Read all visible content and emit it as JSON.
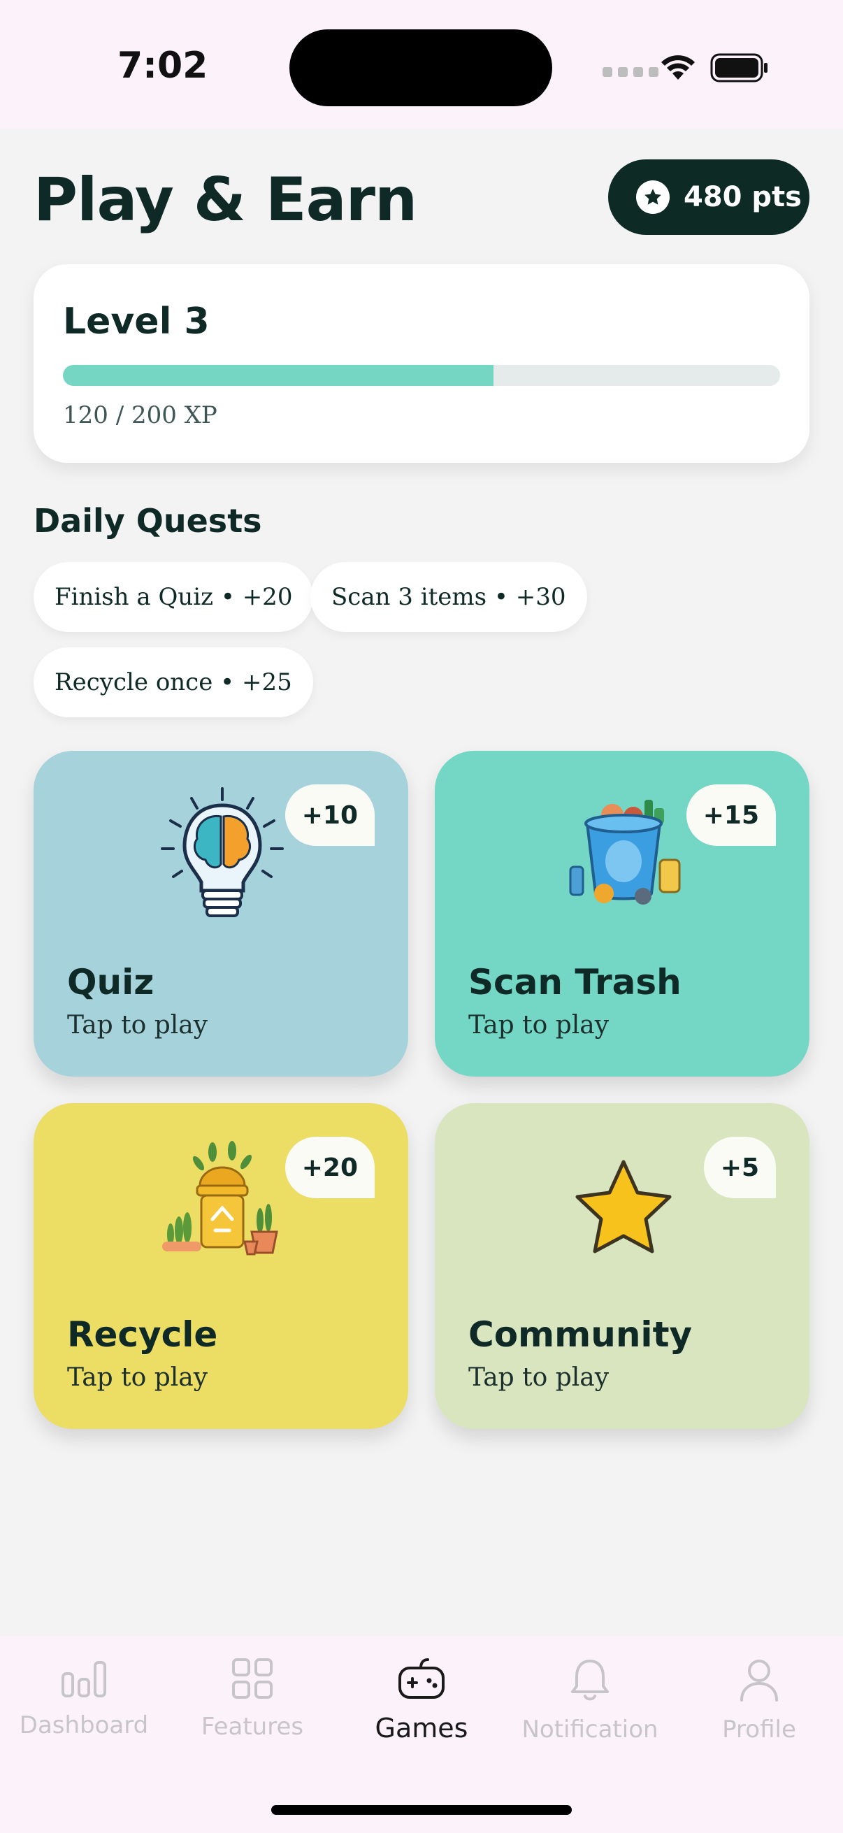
{
  "status_bar": {
    "time": "7:02"
  },
  "header": {
    "title": "Play & Earn",
    "points": "480 pts"
  },
  "level": {
    "title": "Level 3",
    "xp": "120 / 200 XP",
    "progress": 0.6
  },
  "quests": {
    "title": "Daily Quests",
    "items": [
      "Finish a Quiz • +20",
      "Scan 3 items • +30",
      "Recycle once • +25"
    ]
  },
  "games": [
    {
      "title": "Quiz",
      "subtitle": "Tap to play",
      "reward": "+10",
      "color": "#a6d2db",
      "icon": "lightbulb-brain-icon"
    },
    {
      "title": "Scan Trash",
      "subtitle": "Tap to play",
      "reward": "+15",
      "color": "#74d6c4",
      "icon": "trash-can-icon"
    },
    {
      "title": "Recycle",
      "subtitle": "Tap to play",
      "reward": "+20",
      "color": "#ecdd65",
      "icon": "recycle-bin-plants-icon"
    },
    {
      "title": "Community",
      "subtitle": "Tap to play",
      "reward": "+5",
      "color": "#d8e5bf",
      "icon": "star-icon"
    }
  ],
  "tabs": [
    {
      "label": "Dashboard",
      "icon": "bar-chart-icon",
      "active": false
    },
    {
      "label": "Features",
      "icon": "grid-icon",
      "active": false
    },
    {
      "label": "Games",
      "icon": "gamepad-icon",
      "active": true
    },
    {
      "label": "Notification",
      "icon": "bell-icon",
      "active": false
    },
    {
      "label": "Profile",
      "icon": "person-icon",
      "active": false
    }
  ]
}
